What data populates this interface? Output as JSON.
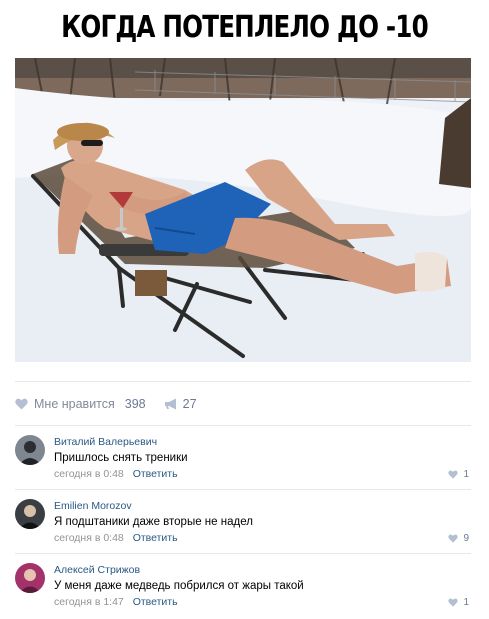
{
  "meme": {
    "title": "КОГДА ПОТЕПЛЕЛО ДО -10",
    "photo_icon": "man-sunbathing-in-snow-image"
  },
  "post_actions": {
    "like_label": "Мне нравится",
    "like_count": "398",
    "share_count": "27",
    "like_icon": "heart-icon",
    "share_icon": "megaphone-icon"
  },
  "comments": [
    {
      "author": "Виталий Валерьевич",
      "text": "Пришлось снять треники",
      "time": "сегодня в 0:48",
      "reply": "Ответить",
      "likes": "1"
    },
    {
      "author": "Emilien Morozov",
      "text": "Я подштаники даже вторые не надел",
      "time": "сегодня в 0:48",
      "reply": "Ответить",
      "likes": "9"
    },
    {
      "author": "Алексей Стрижов",
      "text": "У меня даже медведь побрился от жары такой",
      "time": "сегодня в 1:47",
      "reply": "Ответить",
      "likes": "1"
    }
  ],
  "colors": {
    "link": "#2a5885",
    "meta": "#939393",
    "divider": "#e7e8ec",
    "icon": "#b4c0d2"
  }
}
